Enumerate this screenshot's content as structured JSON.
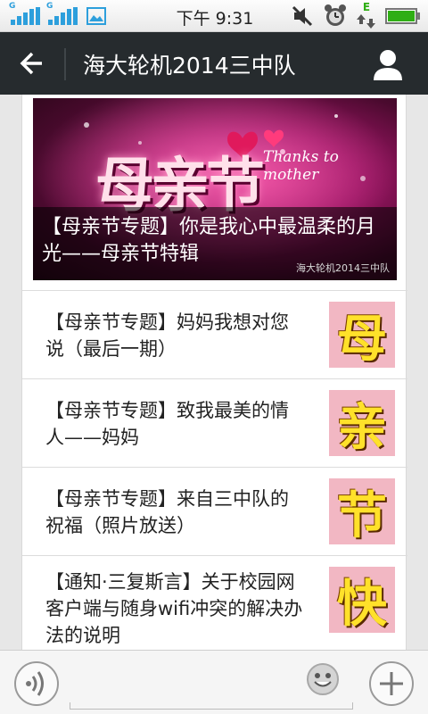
{
  "status_bar": {
    "time": "下午 9:31",
    "network_labels": [
      "G",
      "G"
    ],
    "icons": [
      "signal-icon",
      "signal-icon",
      "image-icon",
      "mute-icon",
      "alarm-icon",
      "data-icon",
      "battery-icon"
    ],
    "data_label": "E",
    "battery_color": "#2fae14"
  },
  "header": {
    "title": "海大轮机2014三中队"
  },
  "feed": {
    "hero": {
      "caption": "【母亲节专题】你是我心中最温柔的月光——母亲节特辑",
      "image_text": "母亲节",
      "image_subtext": "Thanks to mother",
      "watermark": "海大轮机2014三中队"
    },
    "items": [
      {
        "title": "【母亲节专题】妈妈我想对您说（最后一期）",
        "thumb_char": "母"
      },
      {
        "title": "【母亲节专题】致我最美的情人——妈妈",
        "thumb_char": "亲"
      },
      {
        "title": "【母亲节专题】来自三中队的祝福（照片放送）",
        "thumb_char": "节"
      },
      {
        "title": "【通知·三复斯言】关于校园网客户端与随身wifi冲突的解决办法的说明",
        "thumb_char": "快"
      }
    ]
  },
  "colors": {
    "title_bar": "#262b2e",
    "signal": "#2d9fdc",
    "thumb_bg": "#f2b7c3",
    "thumb_text": "#ffe12a"
  }
}
